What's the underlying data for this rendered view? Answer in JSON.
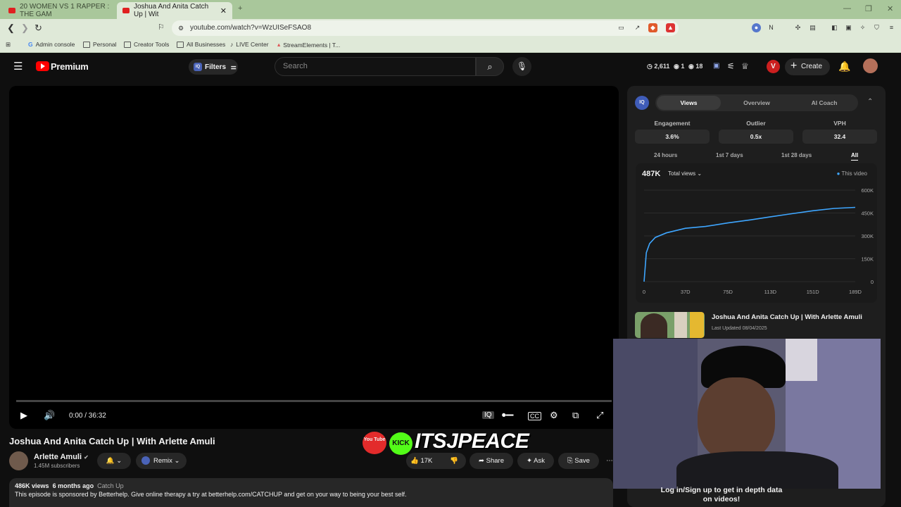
{
  "browser": {
    "tabs": [
      {
        "label": "20 WOMEN VS 1 RAPPER : THE GAM"
      },
      {
        "label": "Joshua And Anita Catch Up | Wit"
      }
    ],
    "url": "youtube.com/watch?v=WzUISeFSAO8",
    "bookmarks": [
      "Admin console",
      "Personal",
      "Creator Tools",
      "All Businesses",
      "LIVE Center",
      "StreamElements | T..."
    ]
  },
  "header": {
    "logo": "Premium",
    "filters_label": "Filters",
    "search_placeholder": "Search",
    "stats": {
      "views": "2,611",
      "count_a": "1",
      "count_b": "18"
    },
    "create_label": "Create",
    "v_badge": "V"
  },
  "player": {
    "time": "0:00 / 36:32"
  },
  "video": {
    "title": "Joshua And Anita Catch Up | With Arlette Amuli",
    "channel": "Arlette Amuli",
    "subscribers": "1.45M subscribers",
    "remix_label": "Remix",
    "likes": "17K",
    "share_label": "Share",
    "ask_label": "Ask",
    "save_label": "Save",
    "meta_views": "486K views",
    "meta_age": "6 months ago",
    "meta_tag": "Catch Up",
    "description": "This episode is sponsored by Betterhelp. Give online therapy a try at betterhelp.com/CATCHUP and get on your way to being your best self."
  },
  "overlay": {
    "yt_text": "You Tube",
    "kick_text": "KICK",
    "brand": "ITSJPEACE"
  },
  "panel": {
    "tabs": [
      "Views",
      "Overview",
      "AI Coach"
    ],
    "metrics": [
      {
        "label": "Engagement",
        "value": "3.6%"
      },
      {
        "label": "Outlier",
        "value": "0.5x"
      },
      {
        "label": "VPH",
        "value": "32.4"
      }
    ],
    "ranges": [
      "24 hours",
      "1st 7 days",
      "1st 28 days",
      "All"
    ],
    "total": "487K",
    "select_label": "Total views",
    "legend": "This video",
    "related_title": "Joshua And Anita Catch Up | With Arlette Amuli",
    "related_updated": "Last Updated 08/04/2025",
    "login_text": "Log in/Sign up to get in depth data on videos!"
  },
  "chart_data": {
    "type": "line",
    "series": [
      {
        "name": "This video",
        "x": [
          0,
          2,
          5,
          10,
          20,
          37,
          55,
          75,
          95,
          113,
          130,
          151,
          170,
          189
        ],
        "y": [
          0,
          190000,
          250000,
          290000,
          320000,
          350000,
          362000,
          385000,
          405000,
          425000,
          443000,
          465000,
          480000,
          487000
        ]
      }
    ],
    "x_ticks": [
      "0",
      "37D",
      "75D",
      "113D",
      "151D",
      "189D"
    ],
    "y_ticks": [
      "600K",
      "450K",
      "300K",
      "150K",
      "0"
    ],
    "xlim": [
      0,
      189
    ],
    "ylim": [
      0,
      600000
    ],
    "color": "#3ea6ff"
  }
}
